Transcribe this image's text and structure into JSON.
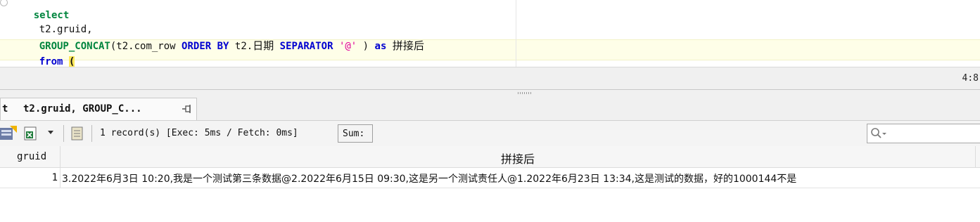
{
  "editor": {
    "line1": "select",
    "line2": "t2.gruid,",
    "line3": {
      "func": "GROUP_CONCAT",
      "arg_open": "(t2.com_row ",
      "order_by": "ORDER BY",
      "col_prefix": " t2.",
      "col_cn": "日期",
      "separator": "SEPARATOR",
      "sep_value": "'@'",
      "close": " ) ",
      "as_kw": "as",
      "alias": "拼接后"
    },
    "line4": {
      "from_kw": "from",
      "paren": "("
    }
  },
  "status": {
    "position": "4:8"
  },
  "results": {
    "tab_prefix": "t",
    "tab_label": "t2.gruid, GROUP_C...",
    "record_info": "1 record(s) [Exec: 5ms / Fetch: 0ms]",
    "sum_label": "Sum:",
    "columns": [
      "gruid",
      "拼接后"
    ],
    "rows": [
      {
        "gruid": "1",
        "concat": "3.2022年6月3日 10:20,我是一个测试第三条数据@2.2022年6月15日 09:30,这是另一个测试责任人@1.2022年6月23日 13:34,这是测试的数据，好的1000144不是"
      }
    ]
  },
  "colors": {
    "keyword_blue": "#0000d0",
    "function_green": "#00853e",
    "string_magenta": "#e0009a",
    "current_line": "#fefee8"
  },
  "icons": [
    "fold-marker-icon",
    "pin-icon",
    "export-icon",
    "excel-icon",
    "dropdown-arrow-icon",
    "notes-icon",
    "search-icon"
  ]
}
